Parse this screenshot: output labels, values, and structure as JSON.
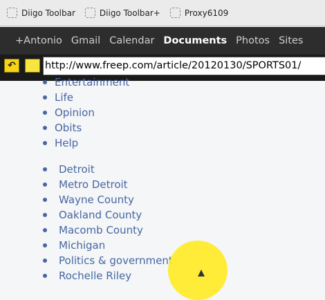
{
  "bookmarks": [
    {
      "label": "Diigo Toolbar"
    },
    {
      "label": "Diigo Toolbar+"
    },
    {
      "label": "Proxy6109"
    }
  ],
  "google_bar": {
    "items": [
      "+Antonio",
      "Gmail",
      "Calendar",
      "Documents",
      "Photos",
      "Sites"
    ],
    "active": "Documents"
  },
  "address": {
    "url": "http://www.freep.com/article/20120130/SPORTS01/"
  },
  "list_top": [
    "Entertainment",
    "Life",
    "Opinion",
    "Obits",
    "Help"
  ],
  "list_news": [
    "Detroit",
    "Metro Detroit",
    "Wayne County",
    "Oakland County",
    "Macomb County",
    "Michigan",
    "Politics & government",
    "Rochelle Riley"
  ],
  "colors": {
    "link": "#4766a3",
    "highlight": "#ffeb1e"
  }
}
